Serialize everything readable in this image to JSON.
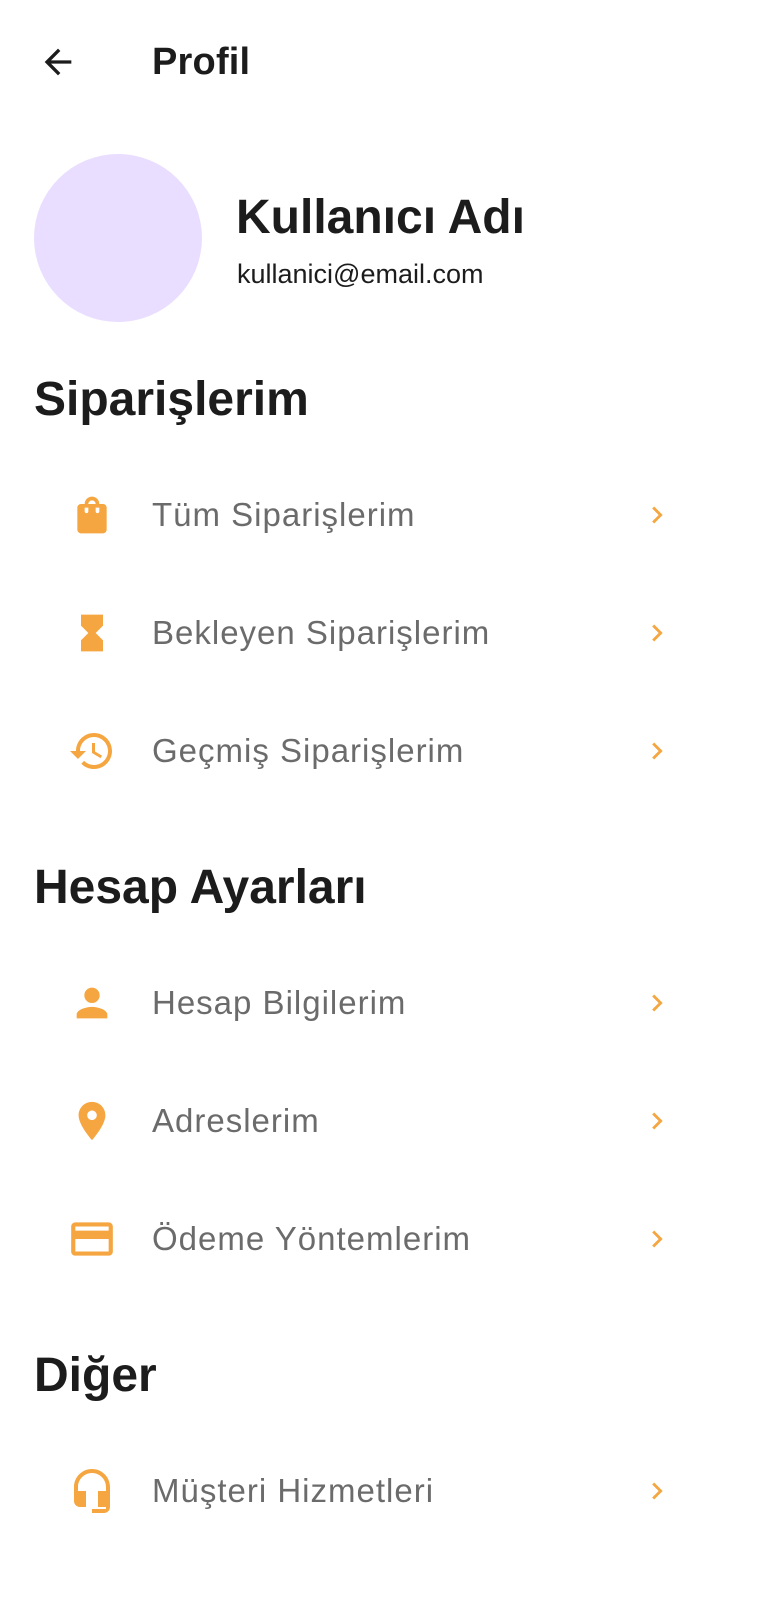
{
  "appbar": {
    "title": "Profil",
    "back_icon": "arrow-back-icon"
  },
  "profile": {
    "name": "Kullanıcı Adı",
    "email": "kullanici@email.com",
    "avatar_color": "#e9deff"
  },
  "accent_color": "#f5a640",
  "sections": [
    {
      "title": "Siparişlerim",
      "items": [
        {
          "label": "Tüm Siparişlerim",
          "icon": "shopping-bag-icon"
        },
        {
          "label": "Bekleyen Siparişlerim",
          "icon": "hourglass-icon"
        },
        {
          "label": "Geçmiş Siparişlerim",
          "icon": "history-icon"
        }
      ]
    },
    {
      "title": "Hesap Ayarları",
      "items": [
        {
          "label": "Hesap Bilgilerim",
          "icon": "person-icon"
        },
        {
          "label": "Adreslerim",
          "icon": "location-pin-icon"
        },
        {
          "label": "Ödeme Yöntemlerim",
          "icon": "credit-card-icon"
        }
      ]
    },
    {
      "title": "Diğer",
      "items": [
        {
          "label": "Müşteri Hizmetleri",
          "icon": "headset-icon"
        }
      ]
    }
  ]
}
